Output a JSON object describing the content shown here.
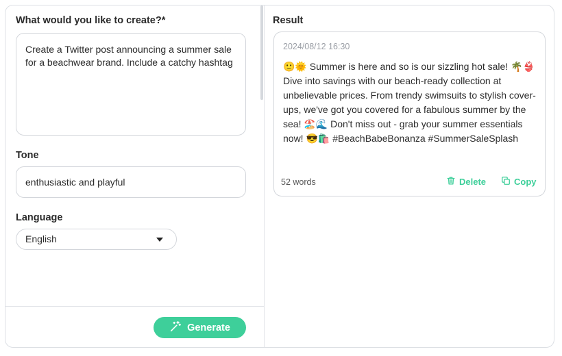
{
  "left": {
    "prompt_label": "What would you like to create?*",
    "prompt_value": "Create a Twitter post announcing a summer sale for a beachwear brand. Include a catchy hashtag",
    "tone_label": "Tone",
    "tone_value": "enthusiastic and playful",
    "language_label": "Language",
    "language_value": "English",
    "generate_label": "Generate"
  },
  "right": {
    "result_label": "Result",
    "timestamp": "2024/08/12 16:30",
    "result_text": "🙂🌞 Summer is here and so is our sizzling hot sale! 🌴👙 Dive into savings with our beach-ready collection at unbelievable prices. From trendy swimsuits to stylish cover-ups, we've got you covered for a fabulous summer by the sea! 🏖️🌊 Don't miss out - grab your summer essentials now! 😎🛍️ #BeachBabeBonanza #SummerSaleSplash",
    "word_count": "52 words",
    "delete_label": "Delete",
    "copy_label": "Copy"
  },
  "colors": {
    "accent": "#3ecf9a",
    "border": "#d3d6db",
    "muted_text": "#9a9ea5"
  },
  "icons": {
    "generate": "magic-wand-icon",
    "delete": "trash-icon",
    "copy": "copy-icon",
    "dropdown": "caret-down-icon"
  }
}
